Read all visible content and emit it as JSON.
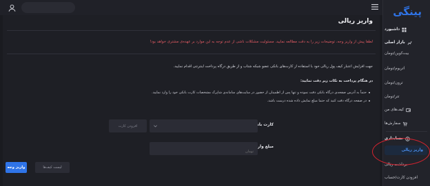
{
  "app": {
    "logo_text": "پینگی",
    "brand_color": "#2f74e8",
    "annotation_color": "#d8232f"
  },
  "topbar": {
    "user_icon": "user-icon",
    "menu_icon": "menu-icon"
  },
  "sidebar": {
    "items": [
      {
        "label": "داشبورد",
        "icon": "dashboard-icon"
      },
      {
        "label": "بازار اصلی",
        "icon": "market-icon"
      },
      {
        "label": "بیت‌کوین/تومان"
      },
      {
        "label": "اتریوم/تومان"
      },
      {
        "label": "ترون/تومان"
      },
      {
        "label": "تتر/تومان"
      },
      {
        "label": "کیف‌های من",
        "icon": "wallet-icon"
      },
      {
        "label": "سفارش‌ها",
        "icon": "orders-icon"
      },
      {
        "label": "حسابداری",
        "icon": "accounting-icon"
      },
      {
        "label": "واریز ریالی"
      },
      {
        "label": "برداشت ریالی"
      },
      {
        "label": "افزودن کارت/حساب"
      }
    ]
  },
  "main": {
    "title": "واریز ریالی",
    "warning": "لطفا پیش از واریز وجه، توضیحات زیر را به دقت مطالعه نمایید. مسئولیت مشکلات ناشی از عدم توجه به این موارد بر عهده‌ی مشتری خواهد بود!",
    "intro": "جهت افزایش اعتبار کیف پول ریالی خود با استفاده از کارت‌های بانکی عضو شبکه شتاب و از طریق درگاه پرداخت اینترنتی اقدام نمایید.",
    "notes_heading": "در هنگام پرداخت به نکات زیر دقت نمایید:",
    "notes": [
      "حتماً به آدرس صفحه‌ی درگاه بانکی دقت نموده و تنها پس از اطمینان از حضور در سایت‌های سامانه‌ی شاپرک مشخصات کارت بانکی خود را وارد نمایید.",
      "در صفحه درگاه دقت کنید که حتما مبلغ نمایش داده شده درست باشد."
    ],
    "bank_card_label": "کارت بانکی:",
    "add_card_label": "افزودن کارت",
    "amount_label": "مبلغ واریزی به تومان:",
    "amount_placeholder": "تومان",
    "deposit_button": "واریز وجه",
    "wallets_button": "لیست کیف‌ها"
  }
}
